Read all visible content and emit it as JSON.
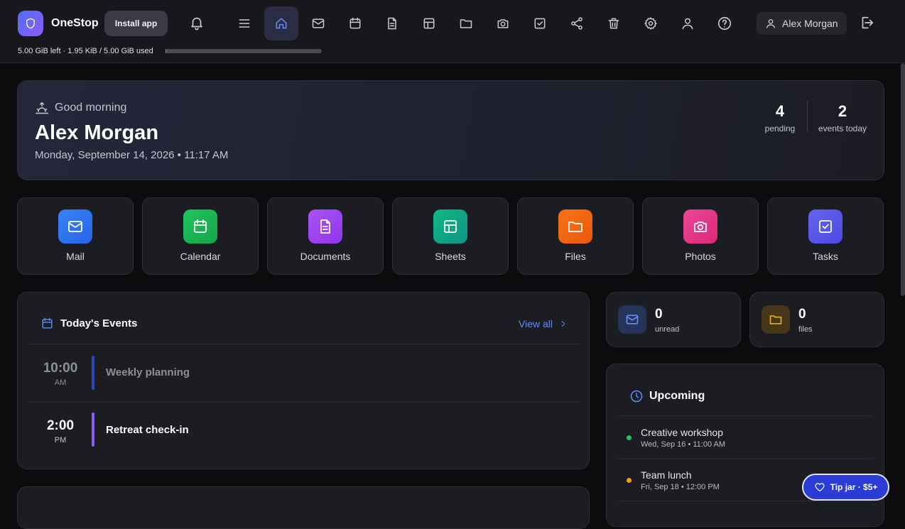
{
  "app": {
    "name": "OneStop",
    "install_label": "Install app"
  },
  "storage": {
    "text": "5.00 GiB left · 1.95 KiB / 5.00 GiB used",
    "used_fraction": 0.0004
  },
  "nav": {
    "items": [
      "menu-icon",
      "home-icon",
      "mail-icon",
      "calendar-icon",
      "document-icon",
      "sheet-icon",
      "folder-icon",
      "camera-icon",
      "checkbox-icon",
      "share-icon",
      "trash-icon",
      "gear-icon",
      "user-icon",
      "help-icon"
    ],
    "active": "home-icon"
  },
  "user": {
    "name": "Alex Morgan"
  },
  "hero": {
    "greeting": "Good morning",
    "name": "Alex Morgan",
    "datetime": "Monday, September 14, 2026 • 11:17 AM",
    "stats": [
      {
        "num": "4",
        "label": "pending"
      },
      {
        "num": "2",
        "label": "events today"
      }
    ]
  },
  "tiles": [
    {
      "label": "Mail",
      "icon": "mail-icon",
      "color": "#3b82f6"
    },
    {
      "label": "Calendar",
      "icon": "calendar-icon",
      "color": "#22c55e"
    },
    {
      "label": "Documents",
      "icon": "document-icon",
      "color": "#a855f7"
    },
    {
      "label": "Sheets",
      "icon": "sheet-icon",
      "color": "#10b981"
    },
    {
      "label": "Files",
      "icon": "folder-icon",
      "color": "#f97316"
    },
    {
      "label": "Photos",
      "icon": "camera-icon",
      "color": "#ec4899"
    },
    {
      "label": "Tasks",
      "icon": "checkbox-icon",
      "color": "#6366f1"
    }
  ],
  "events": {
    "title": "Today's Events",
    "view_all": "View all",
    "items": [
      {
        "time": "10:00",
        "ampm": "AM",
        "title": "Weekly planning",
        "color": "#3b5bdb",
        "past": true
      },
      {
        "time": "2:00",
        "ampm": "PM",
        "title": "Retreat check-in",
        "color": "#8b5cf6",
        "past": false
      }
    ]
  },
  "mini": [
    {
      "num": "0",
      "label": "unread",
      "icon": "mail-icon"
    },
    {
      "num": "0",
      "label": "files",
      "icon": "folder-icon"
    }
  ],
  "upcoming": {
    "title": "Upcoming",
    "items": [
      {
        "title": "Creative workshop",
        "date": "Wed, Sep 16 • 11:00 AM",
        "color": "#22c55e"
      },
      {
        "title": "Team lunch",
        "date": "Fri, Sep 18 • 12:00 PM",
        "color": "#f59e0b"
      }
    ]
  },
  "tip": {
    "label": "Tip jar · $5+"
  }
}
